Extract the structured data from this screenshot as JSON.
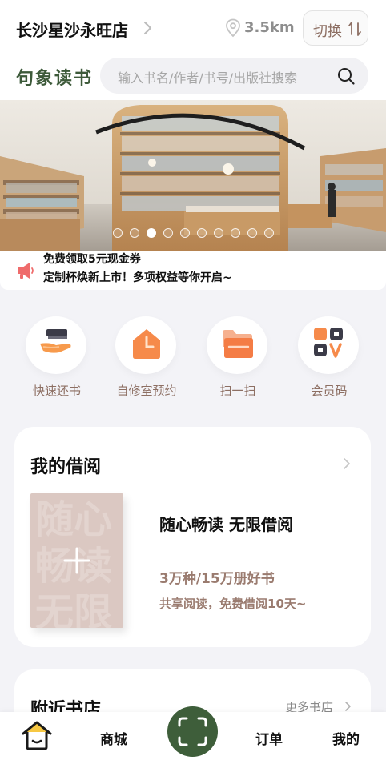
{
  "header": {
    "store_name": "长沙星沙永旺店",
    "distance": "3.5km",
    "switch_label": "切换",
    "icons": [
      "chevron-right-icon",
      "location-pin-icon",
      "swap-arrows-icon"
    ]
  },
  "search": {
    "logo": "句象读书",
    "placeholder": "输入书名/作者/书号/出版社搜索",
    "icon": "search-icon"
  },
  "banner": {
    "image": "bookstore-interior",
    "slide_count": 10,
    "active_slide": 3
  },
  "notice": {
    "icon": "megaphone-icon",
    "line1": "免费领取5元现金券",
    "line2": "定制杯焕新上市！多项权益等你开启~"
  },
  "quick_actions": [
    {
      "label": "快速还书",
      "icon": "hand-book-icon"
    },
    {
      "label": "自修室预约",
      "icon": "study-room-clock-icon"
    },
    {
      "label": "扫一扫",
      "icon": "scan-folder-icon"
    },
    {
      "label": "会员码",
      "icon": "member-qr-icon"
    }
  ],
  "borrow": {
    "title": "我的借阅",
    "watermark": "随心畅读无限",
    "headline": "随心畅读 无限借阅",
    "count": "3万种/15万册好书",
    "subtitle": "共享阅读，免费借阅10天~"
  },
  "nearby": {
    "title": "附近书店",
    "more": "更多书店"
  },
  "tabbar": {
    "tabs": [
      {
        "label": "",
        "icon": "home-icon"
      },
      {
        "label": "商城"
      },
      {
        "label": "",
        "icon": "scan-icon"
      },
      {
        "label": "订单"
      },
      {
        "label": "我的"
      }
    ]
  },
  "colors": {
    "accent_brown": "#8d6f63",
    "brand_green": "#3e5e3a",
    "page_bg": "#f3f3f7",
    "book_placeholder": "#dbc8c2"
  }
}
